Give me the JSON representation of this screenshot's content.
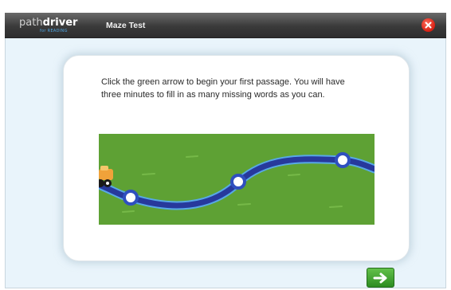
{
  "app": {
    "logo_prefix": "path",
    "logo_brand": "driver",
    "logo_tagline": "for READING",
    "title": "Maze Test"
  },
  "icons": {
    "close": "close-icon",
    "next": "right-arrow-icon",
    "car": "car-icon"
  },
  "instructions": "Click the green arrow to begin your first passage. You will have three minutes to fill in as many missing words as you can.",
  "colors": {
    "titlebar": "#3a3a3a",
    "background": "#e9f4fb",
    "grass": "#5ea134",
    "road": "#2f4fbf",
    "close": "#d61f12",
    "next": "#3fa52e"
  }
}
